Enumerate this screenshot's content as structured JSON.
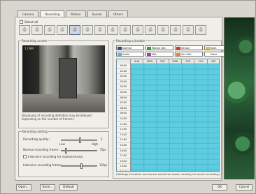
{
  "tabs": [
    "Camera",
    "Recording",
    "Motion",
    "Sensor",
    "Others"
  ],
  "active_tab": 1,
  "select_all_label": "Select all",
  "cameras": [
    {
      "icon": "camera-icon"
    },
    {
      "icon": "camera-icon"
    },
    {
      "icon": "camera-icon"
    },
    {
      "icon": "camera-icon"
    },
    {
      "icon": "camera-icon"
    },
    {
      "icon": "camera-icon"
    },
    {
      "icon": "camera-icon"
    },
    {
      "icon": "camera-icon"
    },
    {
      "icon": "camera-icon"
    },
    {
      "icon": "camera-icon"
    },
    {
      "icon": "camera-icon"
    },
    {
      "icon": "camera-icon"
    },
    {
      "icon": "camera-icon"
    },
    {
      "icon": "camera-icon"
    },
    {
      "icon": "camera-icon"
    }
  ],
  "selected_camera": 4,
  "recording_screen": {
    "title": "Recording screen",
    "stamp": "1 CAM",
    "note": "Displaying of recording definition may be delayed depending on the number of frames.)"
  },
  "recording_setting": {
    "title": "Recording setting",
    "quality_label": "Recording quality :",
    "quality_value": "5",
    "quality_low": "Low",
    "quality_high": "High",
    "normal_frame_label": "Normal recording frame :",
    "normal_frame_value": "5fps",
    "intensive_checkbox": "Intensive recording for motion/sensor",
    "intensive_frame_label": "Intensive recording frame :",
    "intensive_frame_value": "15fps"
  },
  "recording_schedule": {
    "title": "Recording schedule",
    "legend": [
      {
        "label": "Normal",
        "color": "#2e3f9e"
      },
      {
        "label": "Motion Det.",
        "color": "#3c9a3c"
      },
      {
        "label": "Sensor",
        "color": "#c0392b"
      },
      {
        "label": "Both",
        "color": "#e4c21e"
      },
      {
        "label": "Audio",
        "color": "#4fb6e6"
      },
      {
        "label": "Mot.",
        "color": "#b13ab0"
      },
      {
        "label": "Sen.Mot.",
        "color": "#e08a1e"
      },
      {
        "label": "None",
        "color": "#ffffff"
      }
    ],
    "days": [
      "SUN",
      "MON",
      "TUE",
      "WED",
      "THU",
      "FRI",
      "SAT"
    ],
    "times": [
      "00:00",
      "01:00",
      "02:00",
      "03:00",
      "04:00",
      "05:00",
      "06:00",
      "07:00",
      "08:00",
      "09:00",
      "10:00",
      "11:00",
      "12:00",
      "13:00",
      "14:00",
      "15:00",
      "16:00",
      "17:00",
      "18:00",
      "19:00",
      "20:00",
      "21:00",
      "22:00",
      "23:00",
      "24:00"
    ],
    "note": "(Settings of motion and sensor should be made correctly for event recording.)"
  },
  "buttons": {
    "open": "Open...",
    "save": "Save...",
    "default": "Default",
    "ok": "OK",
    "cancel": "Cancel"
  }
}
